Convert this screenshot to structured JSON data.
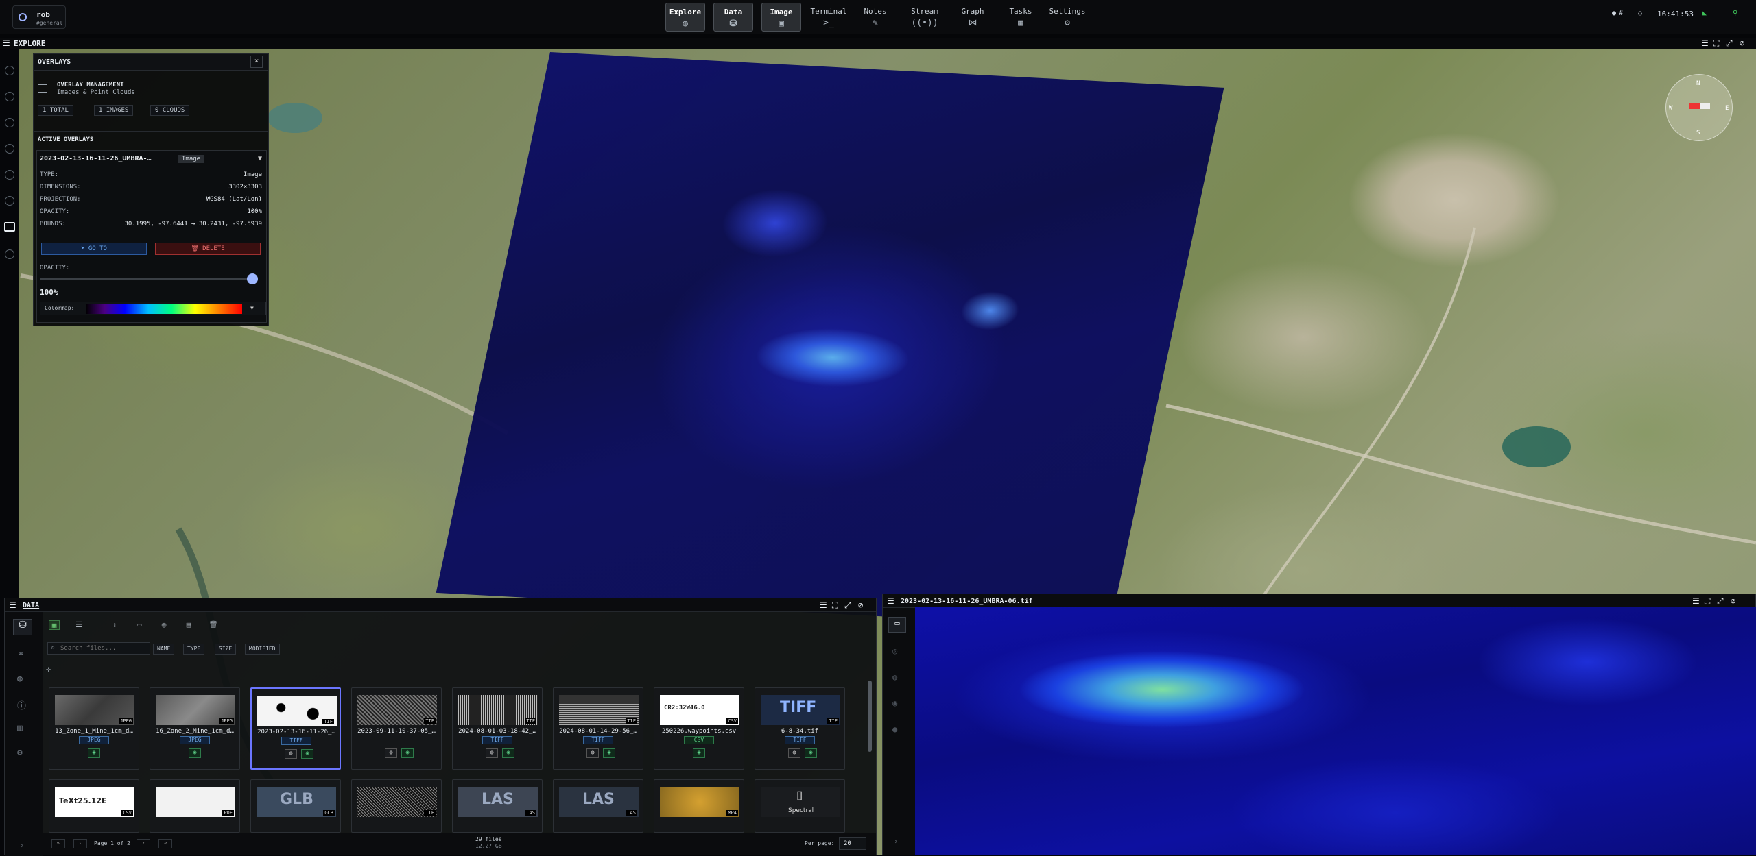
{
  "app": {
    "name": "rob",
    "workspace": "#general"
  },
  "nav": [
    {
      "label": "Explore",
      "icon": "globe-icon"
    },
    {
      "label": "Data",
      "icon": "database-icon"
    },
    {
      "label": "Image",
      "icon": "image-icon"
    },
    {
      "label": "Terminal",
      "icon": "terminal-icon"
    },
    {
      "label": "Notes",
      "icon": "edit-icon"
    },
    {
      "label": "Stream",
      "icon": "broadcast-icon"
    },
    {
      "label": "Graph",
      "icon": "share-icon"
    },
    {
      "label": "Tasks",
      "icon": "calendar-icon"
    },
    {
      "label": "Settings",
      "icon": "gear-icon"
    }
  ],
  "topright": {
    "hash": "#",
    "time": "16:41:53"
  },
  "explore": {
    "title": "EXPLORE"
  },
  "overlays": {
    "title": "OVERLAYS",
    "mgmt_title": "OVERLAY MANAGEMENT",
    "mgmt_sub": "Images & Point Clouds",
    "stats": [
      "1 TOTAL",
      "1 IMAGES",
      "0 CLOUDS"
    ],
    "active_title": "ACTIVE OVERLAYS",
    "item": {
      "name": "2023-02-13-16-11-26_UMBRA-…",
      "badge": "Image",
      "rows": [
        {
          "k": "TYPE:",
          "v": "Image"
        },
        {
          "k": "DIMENSIONS:",
          "v": "3302×3303"
        },
        {
          "k": "PROJECTION:",
          "v": "WGS84 (Lat/Lon)"
        },
        {
          "k": "OPACITY:",
          "v": "100%"
        },
        {
          "k": "BOUNDS:",
          "v": "30.1995, -97.6441 → 30.2431, -97.5939"
        }
      ],
      "goto": "GO TO",
      "delete": "DELETE",
      "opacity_label": "OPACITY:",
      "opacity_value": "100%",
      "opacity_level": 1.0,
      "colormap_label": "Colormap:"
    }
  },
  "data": {
    "title": "DATA",
    "search_placeholder": "Search files...",
    "sort": [
      "NAME",
      "TYPE",
      "SIZE",
      "MODIFIED"
    ],
    "files_row1": [
      {
        "name": "13_Zone_1_Mine_1cm_d…",
        "tag": "JPEG",
        "ext": "JPEG"
      },
      {
        "name": "16_Zone_2_Mine_1cm_d…",
        "tag": "JPEG",
        "ext": "JPEG"
      },
      {
        "name": "2023-02-13-16-11-26_…",
        "tag": "TIFF",
        "ext": "TIF"
      },
      {
        "name": "2023-09-11-10-37-05_…",
        "tag": "",
        "ext": "TIF"
      },
      {
        "name": "2024-08-01-03-18-42_…",
        "tag": "TIFF",
        "ext": "TIF"
      },
      {
        "name": "2024-08-01-14-29-56_…",
        "tag": "TIFF",
        "ext": "TIF"
      },
      {
        "name": "250226.waypoints.csv",
        "tag": "CSV",
        "ext": "CSV"
      },
      {
        "name": "6-8-34.tif",
        "tag": "TIFF",
        "ext": "TIF"
      }
    ],
    "files_row2": [
      {
        "label": "TeXt25.12E",
        "ext": "CSV"
      },
      {
        "label": "",
        "ext": "PDF"
      },
      {
        "label": "GLB",
        "ext": "GLB"
      },
      {
        "label": "",
        "ext": "TIF"
      },
      {
        "label": "LAS",
        "ext": "LAS"
      },
      {
        "label": "LAS",
        "ext": "LAS"
      },
      {
        "label": "",
        "ext": "MP4"
      },
      {
        "label": "Spectral",
        "ext": ""
      }
    ],
    "csv_thumb_text": "CR2:32W46.0",
    "tiff_thumb_text": "TIFF",
    "page": "Page 1 of 2",
    "count": "29 files",
    "size": "12.27 GB",
    "per_page_label": "Per page:",
    "per_page": "20"
  },
  "preview": {
    "title": "2023-02-13-16-11-26_UMBRA-06.tif"
  },
  "compass": {
    "n": "N",
    "s": "S",
    "e": "E",
    "w": "W"
  }
}
